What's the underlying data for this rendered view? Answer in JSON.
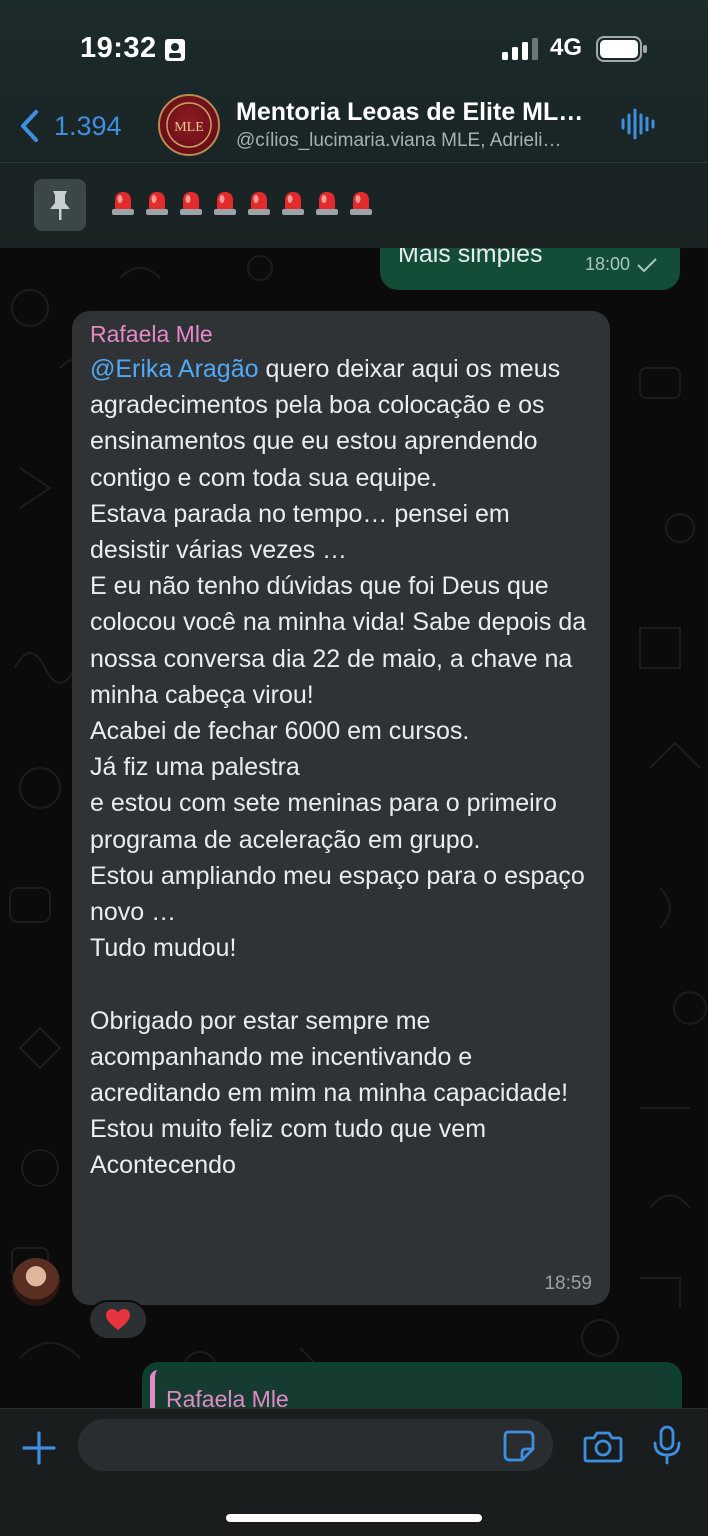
{
  "status_bar": {
    "time": "19:32",
    "network": "4G"
  },
  "header": {
    "back_count": "1.394",
    "title": "Mentoria Leoas de Elite  ML…",
    "subtitle": "@cílios_lucimaria.viana MLE, Adrieli…",
    "avatar_initials": "MLE"
  },
  "pinned": {
    "sirens": 8
  },
  "messages": {
    "outgoing_top": {
      "text": "Mais simples",
      "time": "18:00"
    },
    "incoming": {
      "sender": "Rafaela Mle",
      "mention": "@Erika Aragão",
      "body": " quero deixar aqui os meus agradecimentos pela boa colocação e os ensinamentos que eu estou aprendendo contigo e com toda sua equipe.\nEstava parada no tempo… pensei em desistir várias vezes …\nE eu não tenho dúvidas que foi Deus que colocou você na minha vida! Sabe depois da nossa conversa dia 22 de maio, a chave na minha cabeça virou!\nAcabei de fechar 6000 em cursos.\nJá fiz uma palestra\ne estou com sete meninas para o primeiro programa de aceleração em grupo.\nEstou ampliando meu espaço para o espaço novo …\nTudo mudou!\n\nObrigado por estar sempre me acompanhando me incentivando e acreditando em mim na minha capacidade! Estou muito feliz com tudo que vem\nAcontecendo",
      "time": "18:59",
      "reaction": "heart"
    },
    "outgoing_reply": {
      "quoted_sender": "Rafaela Mle"
    }
  },
  "composer": {
    "value": "",
    "placeholder": ""
  },
  "colors": {
    "accent": "#3d8fe0",
    "sender": "#e38ac6",
    "mention": "#53a8f5",
    "outgoing": "#134d38",
    "incoming": "#303336"
  }
}
